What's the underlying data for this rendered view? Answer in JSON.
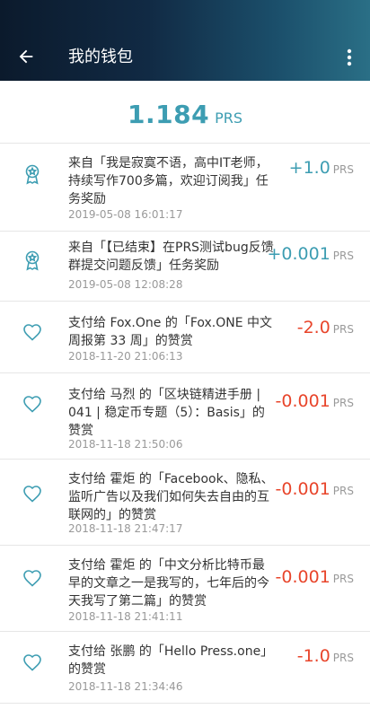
{
  "header": {
    "title": "我的钱包"
  },
  "balance": {
    "amount": "1.184",
    "unit": "PRS"
  },
  "transactions": [
    {
      "icon": "award-icon",
      "description": "来自「我是寂寞不语，高中IT老师，持续写作700多篇，欢迎订阅我」任务奖励",
      "time": "2019-05-08 16:01:17",
      "amount": "+1.0",
      "unit": "PRS",
      "sign": "positive"
    },
    {
      "icon": "award-icon",
      "description": "来自「【已结束】在PRS测试bug反馈群提交问题反馈」任务奖励",
      "time": "2019-05-08 12:08:28",
      "amount": "+0.001",
      "unit": "PRS",
      "sign": "positive"
    },
    {
      "icon": "heart-icon",
      "description": "支付给 Fox.One 的「Fox.ONE 中文周报第 33 周」的赞赏",
      "time": "2018-11-20 21:06:13",
      "amount": "-2.0",
      "unit": "PRS",
      "sign": "negative"
    },
    {
      "icon": "heart-icon",
      "description": "支付给 马烈 的「区块链精进手册 | 041 | 稳定币专题（5）：Basis」的赞赏",
      "time": "2018-11-18 21:50:06",
      "amount": "-0.001",
      "unit": "PRS",
      "sign": "negative"
    },
    {
      "icon": "heart-icon",
      "description": "支付给 霍炬 的「Facebook、隐私、监听广告以及我们如何失去自由的互联网的」的赞赏",
      "time": "2018-11-18 21:47:17",
      "amount": "-0.001",
      "unit": "PRS",
      "sign": "negative"
    },
    {
      "icon": "heart-icon",
      "description": "支付给 霍炬 的「中文分析比特币最早的文章之一是我写的，七年后的今天我写了第二篇」的赞赏",
      "time": "2018-11-18 21:41:11",
      "amount": "-0.001",
      "unit": "PRS",
      "sign": "negative"
    },
    {
      "icon": "heart-icon",
      "description": "支付给 张鹏 的「Hello Press.one」的赞赏",
      "time": "2018-11-18 21:34:46",
      "amount": "-1.0",
      "unit": "PRS",
      "sign": "negative"
    }
  ]
}
